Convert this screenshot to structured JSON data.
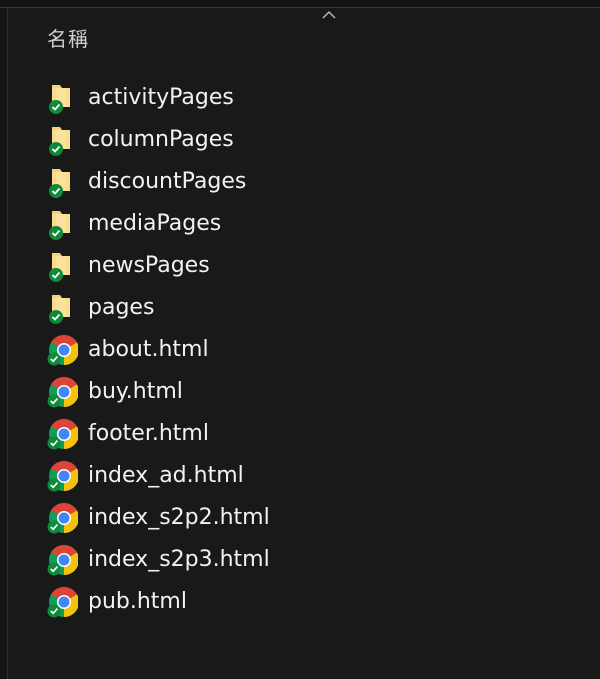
{
  "header": {
    "name_column": "名稱",
    "sort_icon": "chevron-up-icon"
  },
  "colors": {
    "background": "#191919",
    "text": "#f2f2f2",
    "folder": "#f5d27a",
    "sync_ok": "#0f8a3a",
    "chrome_red": "#db4437",
    "chrome_yellow": "#f4c20d",
    "chrome_green": "#0f9d58",
    "chrome_blue": "#4285f4"
  },
  "files": [
    {
      "name": "activityPages",
      "type": "folder",
      "icon": "folder-icon",
      "status_icon": "sync-ok-icon"
    },
    {
      "name": "columnPages",
      "type": "folder",
      "icon": "folder-icon",
      "status_icon": "sync-ok-icon"
    },
    {
      "name": "discountPages",
      "type": "folder",
      "icon": "folder-icon",
      "status_icon": "sync-ok-icon"
    },
    {
      "name": "mediaPages",
      "type": "folder",
      "icon": "folder-icon",
      "status_icon": "sync-ok-icon"
    },
    {
      "name": "newsPages",
      "type": "folder",
      "icon": "folder-icon",
      "status_icon": "sync-ok-icon"
    },
    {
      "name": "pages",
      "type": "folder",
      "icon": "folder-icon",
      "status_icon": "sync-ok-icon"
    },
    {
      "name": "about.html",
      "type": "html",
      "icon": "chrome-icon",
      "status_icon": "sync-ok-icon"
    },
    {
      "name": "buy.html",
      "type": "html",
      "icon": "chrome-icon",
      "status_icon": "sync-ok-icon"
    },
    {
      "name": "footer.html",
      "type": "html",
      "icon": "chrome-icon",
      "status_icon": "sync-ok-icon"
    },
    {
      "name": "index_ad.html",
      "type": "html",
      "icon": "chrome-icon",
      "status_icon": "sync-ok-icon"
    },
    {
      "name": "index_s2p2.html",
      "type": "html",
      "icon": "chrome-icon",
      "status_icon": "sync-ok-icon"
    },
    {
      "name": "index_s2p3.html",
      "type": "html",
      "icon": "chrome-icon",
      "status_icon": "sync-ok-icon"
    },
    {
      "name": "pub.html",
      "type": "html",
      "icon": "chrome-icon",
      "status_icon": "sync-ok-icon"
    }
  ]
}
